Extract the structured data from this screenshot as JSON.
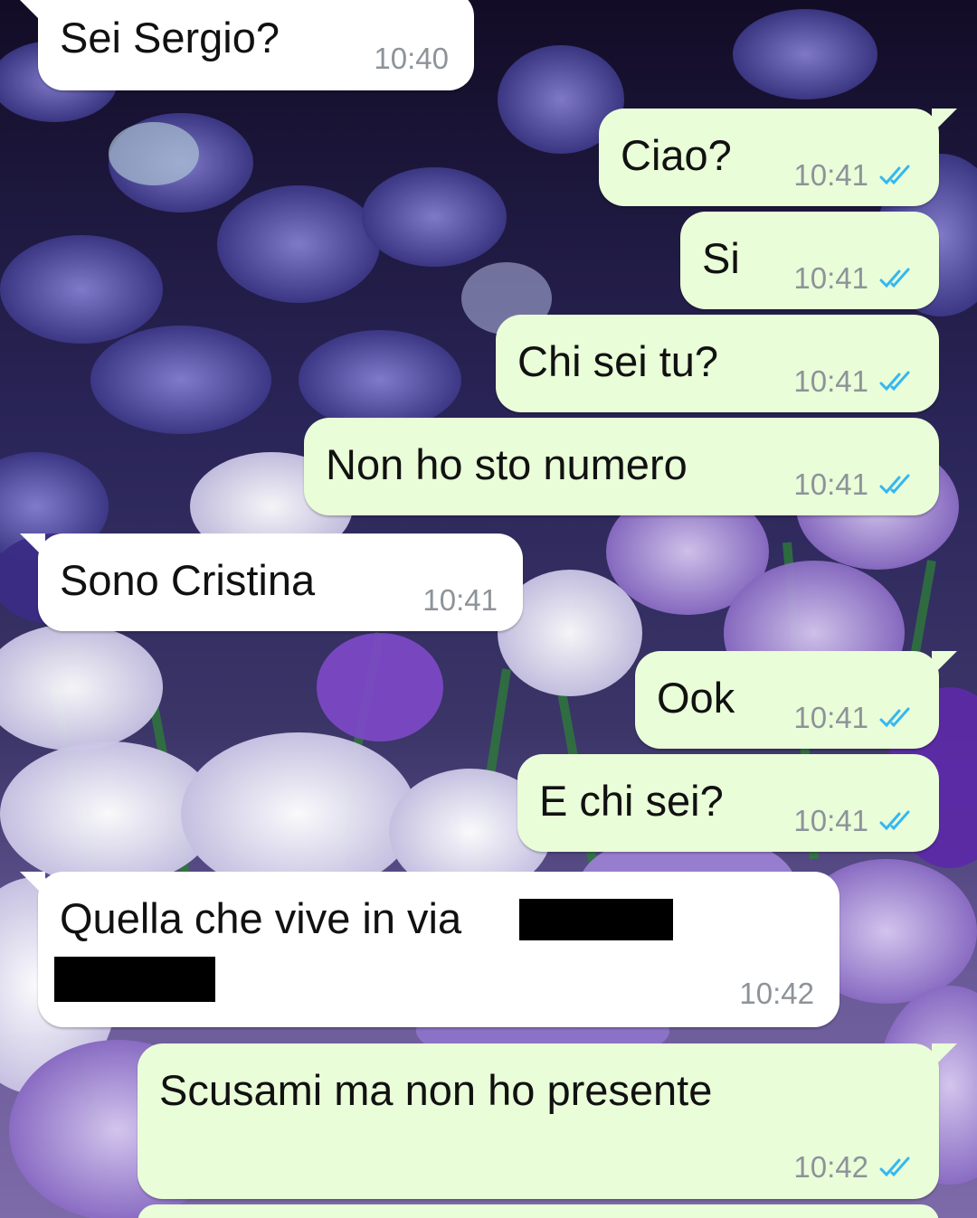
{
  "chat": {
    "messages": [
      {
        "direction": "incoming",
        "text": "Sei Sergio?",
        "time": "10:40"
      },
      {
        "direction": "outgoing",
        "text": "Ciao?",
        "time": "10:41",
        "status": "read"
      },
      {
        "direction": "outgoing",
        "text": "Si",
        "time": "10:41",
        "status": "read"
      },
      {
        "direction": "outgoing",
        "text": "Chi sei tu?",
        "time": "10:41",
        "status": "read"
      },
      {
        "direction": "outgoing",
        "text": "Non ho sto numero",
        "time": "10:41",
        "status": "read"
      },
      {
        "direction": "incoming",
        "text": "Sono Cristina",
        "time": "10:41"
      },
      {
        "direction": "outgoing",
        "text": "Ook",
        "time": "10:41",
        "status": "read"
      },
      {
        "direction": "outgoing",
        "text": "E chi sei?",
        "time": "10:41",
        "status": "read"
      },
      {
        "direction": "incoming",
        "text": "Quella che vive in via",
        "time": "10:42",
        "redacted": true
      },
      {
        "direction": "outgoing",
        "text": "Scusami ma non ho presente",
        "time": "10:42",
        "status": "read"
      }
    ]
  },
  "colors": {
    "incoming_bubble": "#ffffff",
    "outgoing_bubble": "#e9fdd8",
    "read_ticks": "#34b7f1",
    "timestamp": "#8d9399"
  },
  "icons": {
    "read_receipt": "double-check-icon",
    "wallpaper": "crocus-flowers-wallpaper"
  }
}
